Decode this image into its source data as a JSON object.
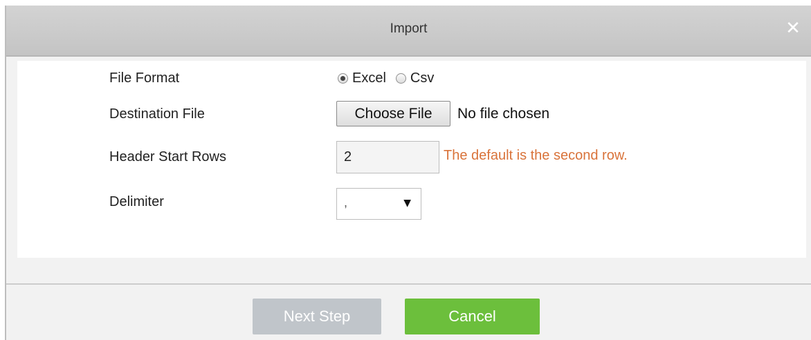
{
  "dialog": {
    "title": "Import",
    "close_symbol": "✕",
    "close_icon": "close-icon"
  },
  "form": {
    "file_format": {
      "label": "File Format",
      "options": [
        "Excel",
        "Csv"
      ],
      "selected": "Excel"
    },
    "destination_file": {
      "label": "Destination File",
      "button_label": "Choose File",
      "status_text": "No file chosen"
    },
    "header_start_rows": {
      "label": "Header Start Rows",
      "value": "2",
      "hint": "The default is the second row."
    },
    "delimiter": {
      "label": "Delimiter",
      "value": ",",
      "caret_symbol": "▼"
    }
  },
  "footer": {
    "next_label": "Next Step",
    "cancel_label": "Cancel"
  },
  "colors": {
    "hint": "#d9733a",
    "cancel_bg": "#6cbf3c",
    "next_bg_disabled": "#c0c5ca"
  }
}
